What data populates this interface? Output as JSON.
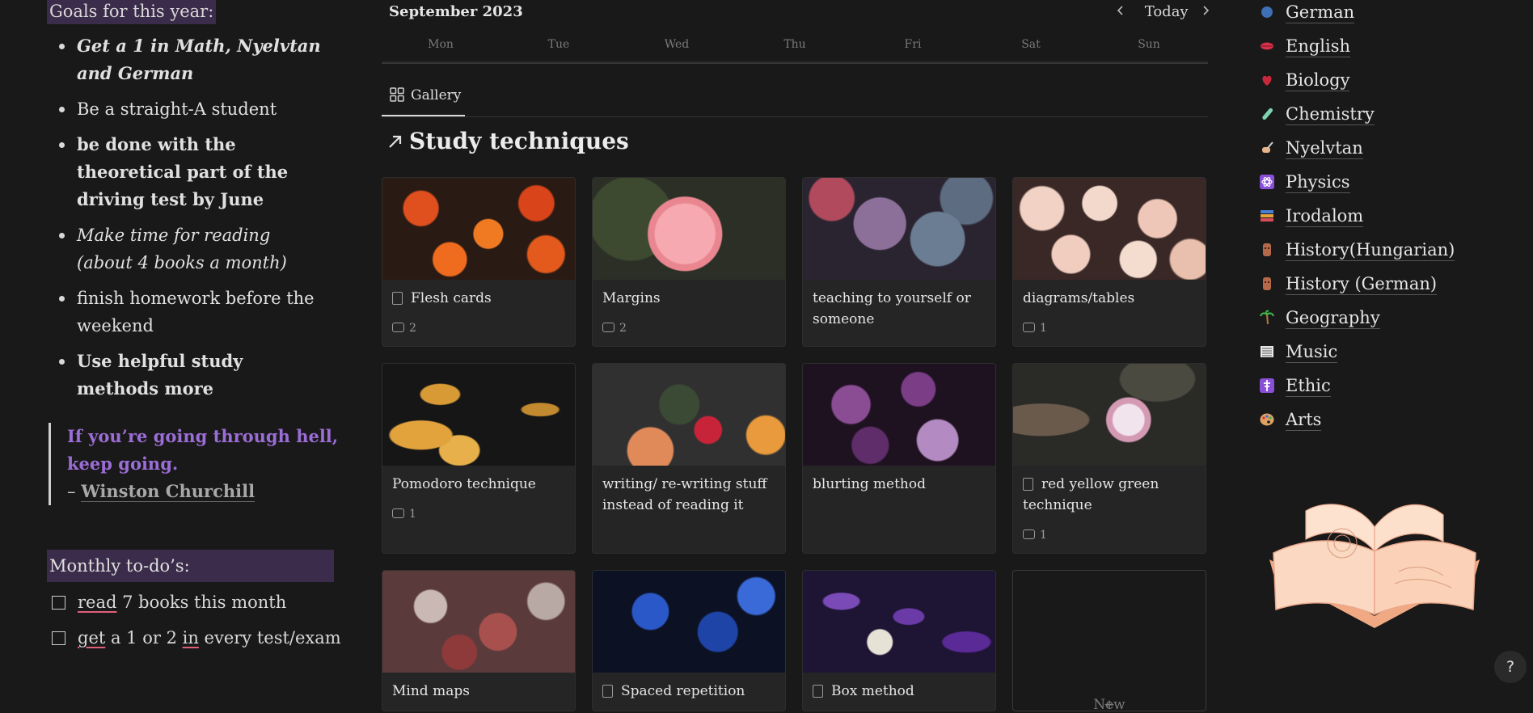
{
  "goals": {
    "title": "Goals for this year:",
    "items": [
      "Get a 1 in Math, Nyelvtan  and German",
      "Be a straight-A student",
      "be done with the theoretical part of the driving test by June",
      "Make time for reading (about 4 books a month)",
      "finish homework before the weekend",
      "Use helpful study methods more"
    ],
    "quote_line1": "If you’re going through hell,",
    "quote_line2": "keep going.",
    "quote_dash": "– ",
    "quote_author": "Winston Churchill"
  },
  "monthly": {
    "title": "Monthly to-do’s:",
    "todo1": {
      "w1": "read",
      "rest": " 7 books this month"
    },
    "todo2": {
      "w1": "get",
      "mid": " a 1 or 2 ",
      "w2": "in",
      "rest": " every test/exam"
    }
  },
  "calendar": {
    "title": "September 2023",
    "today": "Today",
    "days": [
      "Mon",
      "Tue",
      "Wed",
      "Thu",
      "Fri",
      "Sat",
      "Sun"
    ]
  },
  "gallery": {
    "tab": "Gallery",
    "section_title": "Study techniques",
    "new_label": "New",
    "cards": [
      {
        "title": "Flesh cards",
        "comments": "2"
      },
      {
        "title": "Margins",
        "comments": "2"
      },
      {
        "title": "teaching to yourself or someone",
        "comments": ""
      },
      {
        "title": "diagrams/tables",
        "comments": "1"
      },
      {
        "title": "Pomodoro technique",
        "comments": "1"
      },
      {
        "title": "writing/ re-writing stuff instead of reading it",
        "comments": ""
      },
      {
        "title": "blurting method",
        "comments": ""
      },
      {
        "title": "red yellow green technique",
        "comments": "1"
      },
      {
        "title": "Mind maps",
        "comments": ""
      },
      {
        "title": "Spaced repetition",
        "comments": ""
      },
      {
        "title": "Box method",
        "comments": ""
      }
    ]
  },
  "subjects": [
    "German",
    "English",
    "Biology",
    "Chemistry",
    "Nyelvtan",
    "Physics",
    "Irodalom",
    "History(Hungarian)",
    "History (German)",
    "Geography",
    "Music",
    "Ethic",
    "Arts"
  ],
  "help": "?"
}
